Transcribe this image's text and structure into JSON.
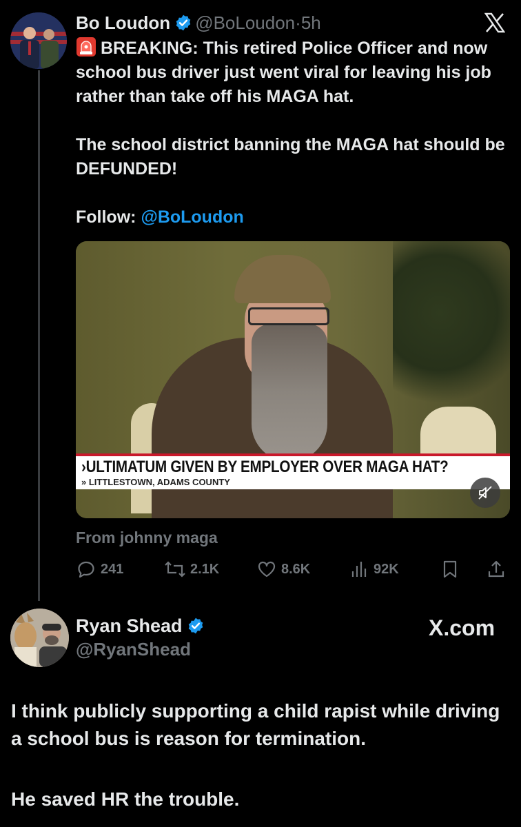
{
  "tweet": {
    "author_name": "Bo Loudon",
    "author_handle": "@BoLoudon",
    "separator": "·",
    "time": "5h",
    "paragraph1": "BREAKING: This retired Police Officer and now school bus driver just went viral for leaving his job rather than take off his MAGA hat.",
    "paragraph2": "The school district banning the MAGA hat should be DEFUNDED!",
    "follow_label": "Follow:",
    "follow_mention": "@BoLoudon",
    "media": {
      "chyron_main": "ULTIMATUM GIVEN BY EMPLOYER OVER MAGA HAT?",
      "chyron_sub": "» LITTLESTOWN, ADAMS COUNTY",
      "chyron_arrow": "›",
      "chyron_color": "#c9182b"
    },
    "source": "From johnny maga",
    "replies": "241",
    "reposts": "2.1K",
    "likes": "8.6K",
    "views": "92K"
  },
  "reply": {
    "author_name": "Ryan Shead",
    "author_handle": "@RyanShead",
    "watermark": "X.com",
    "paragraph1": "I think publicly supporting a child rapist while driving a school bus is reason for termination.",
    "paragraph2": "He saved HR the trouble."
  },
  "colors": {
    "background": "#000000",
    "text": "#e7e9ea",
    "muted": "#71767b",
    "link": "#1d9bf0",
    "verified": "#1d9bf0"
  }
}
